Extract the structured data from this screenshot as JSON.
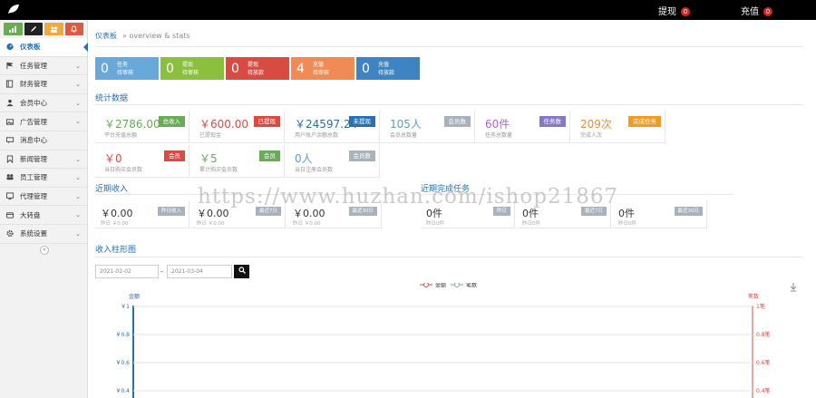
{
  "topbar": {
    "items": [
      {
        "label": "提现",
        "badge": "0"
      },
      {
        "label": "充值",
        "badge": "0"
      }
    ]
  },
  "sidebar": {
    "buttons": [
      {
        "name": "stats",
        "color": "#6aab58"
      },
      {
        "name": "edit",
        "color": "#222222"
      },
      {
        "name": "users",
        "color": "#f0a93b"
      },
      {
        "name": "bell",
        "color": "#d85b45"
      }
    ],
    "items": [
      {
        "label": "仪表板",
        "icon": "tachometer-icon",
        "active": true
      },
      {
        "label": "任务管理",
        "icon": "flag-icon"
      },
      {
        "label": "财务管理",
        "icon": "book-icon"
      },
      {
        "label": "会员中心",
        "icon": "user-icon"
      },
      {
        "label": "广告管理",
        "icon": "picture-icon"
      },
      {
        "label": "消息中心",
        "icon": "message-icon"
      },
      {
        "label": "新闻管理",
        "icon": "bookmark-icon"
      },
      {
        "label": "员工管理",
        "icon": "users-icon"
      },
      {
        "label": "代理管理",
        "icon": "desktop-icon"
      },
      {
        "label": "大转盘",
        "icon": "wheel-icon"
      },
      {
        "label": "系统设置",
        "icon": "gear-icon"
      }
    ]
  },
  "breadcrumb": {
    "title": "仪表板",
    "sub": "» overview & stats"
  },
  "kpis": [
    {
      "value": "0",
      "title": "任务",
      "desc": "待审核",
      "color": "#68a9da"
    },
    {
      "value": "0",
      "title": "提现",
      "desc": "待审核",
      "color": "#8bbf3e"
    },
    {
      "value": "0",
      "title": "提现",
      "desc": "待放款",
      "color": "#d84b43"
    },
    {
      "value": "4",
      "title": "充值",
      "desc": "待审核",
      "color": "#f08b55"
    },
    {
      "value": "0",
      "title": "充值",
      "desc": "待放款",
      "color": "#3f84c2"
    }
  ],
  "stats_title": "统计数据",
  "stats": [
    {
      "value": "￥2786.00",
      "desc": "平台充值总额",
      "tag": "总收入",
      "vcolor": "#6aab58",
      "tcolor": "#6aab58"
    },
    {
      "value": "￥600.00",
      "desc": "已提现金",
      "tag": "已提现",
      "vcolor": "#d84b43",
      "tcolor": "#d84b43"
    },
    {
      "value": "￥24597.24",
      "desc": "用户账户余额总数",
      "tag": "未提现",
      "vcolor": "#2a6fb0",
      "tcolor": "#2a6fb0"
    },
    {
      "value": "105人",
      "desc": "会员总数量",
      "tag": "会员数",
      "vcolor": "#5b9bd5",
      "tcolor": "#a8b2bc"
    },
    {
      "value": "60件",
      "desc": "任务总数量",
      "tag": "任务数",
      "vcolor": "#b465c9",
      "tcolor": "#8878c3"
    },
    {
      "value": "209次",
      "desc": "完成人次",
      "tag": "完成任务",
      "vcolor": "#f08b35",
      "tcolor": "#f09b25"
    },
    {
      "value": "￥0",
      "desc": "当日购买会员数",
      "tag": "会员",
      "vcolor": "#d84b43",
      "tcolor": "#d84b43"
    },
    {
      "value": "￥5",
      "desc": "累计购买会员数",
      "tag": "会员",
      "vcolor": "#6aab58",
      "tcolor": "#6aab58"
    },
    {
      "value": "0人",
      "desc": "当日注册会员数",
      "tag": "会员数",
      "vcolor": "#5b9bd5",
      "tcolor": "#a8b2bc"
    }
  ],
  "income_title": "近期收入",
  "income": [
    {
      "value": "￥0.00",
      "desc": "昨日 ￥0.00",
      "tag": "昨日收入"
    },
    {
      "value": "￥0.00",
      "desc": "昨日 ￥0.00",
      "tag": "最近7日"
    },
    {
      "value": "￥0.00",
      "desc": "昨日 ￥0.00",
      "tag": "最近30日"
    }
  ],
  "tasks_title": "近期完成任务",
  "tasks": [
    {
      "value": "0件",
      "desc": "昨日0件",
      "tag": "昨日"
    },
    {
      "value": "0件",
      "desc": "昨日0件",
      "tag": "最近7日"
    },
    {
      "value": "0件",
      "desc": "昨日0件",
      "tag": "最近30日"
    }
  ],
  "chart_title": "收入柱形图",
  "filter": {
    "start": "2021-02-02",
    "end": "2021-03-04",
    "sep": "-"
  },
  "download_icon": "download-icon",
  "chart_data": {
    "type": "line",
    "legend": [
      "金额",
      "笔数"
    ],
    "y_left_label": "金额",
    "y_right_label": "笔数",
    "y_left_ticks": [
      "￥1",
      "￥0.8",
      "￥0.6",
      "￥0.4"
    ],
    "y_right_ticks": [
      "1笔",
      "0.8笔",
      "0.6笔",
      "0.4笔"
    ],
    "series": [
      {
        "name": "金额",
        "color": "#d84b43",
        "values": []
      },
      {
        "name": "笔数",
        "color": "#8a99a8",
        "values": []
      }
    ]
  },
  "watermark": "https://www.huzhan.com/ishop21867"
}
